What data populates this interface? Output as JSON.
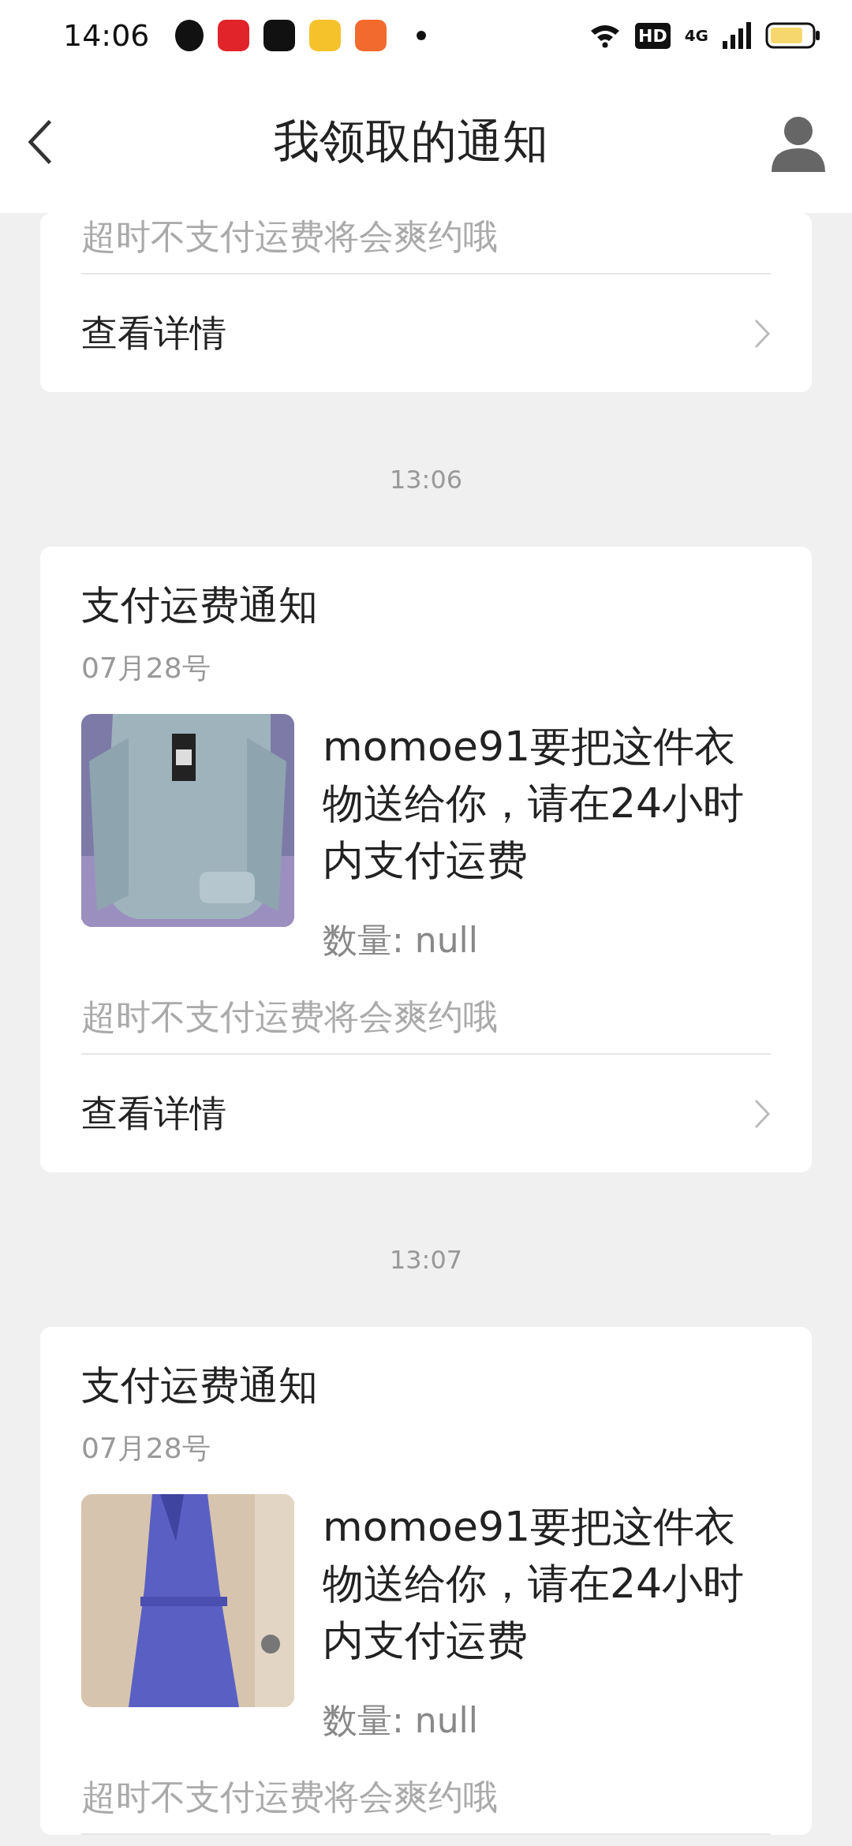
{
  "status_bar": {
    "time": "14:06",
    "hd": "HD",
    "network": "4G"
  },
  "header": {
    "title": "我领取的通知"
  },
  "feed": [
    {
      "kind": "card_tail",
      "footnote": "超时不支付运费将会爽约哦",
      "link": "查看详情"
    },
    {
      "kind": "timestamp",
      "time": "13:06"
    },
    {
      "kind": "card",
      "title": "支付运费通知",
      "date": "07月28号",
      "message": "momoe91要把这件衣物送给你，请在24小时内支付运费",
      "quantity": "数量: null",
      "footnote": "超时不支付运费将会爽约哦",
      "link": "查看详情"
    },
    {
      "kind": "timestamp",
      "time": "13:07"
    },
    {
      "kind": "card",
      "title": "支付运费通知",
      "date": "07月28号",
      "message": "momoe91要把这件衣物送给你，请在24小时内支付运费",
      "quantity": "数量: null",
      "footnote": "超时不支付运费将会爽约哦"
    }
  ]
}
